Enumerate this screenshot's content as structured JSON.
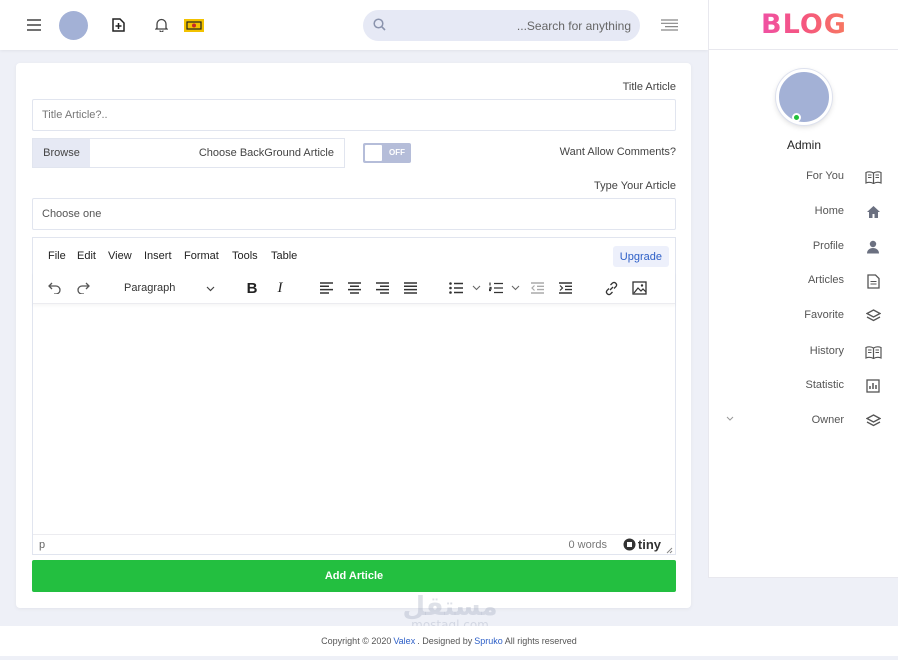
{
  "header": {
    "search_placeholder": "...Search for anything"
  },
  "sidebar": {
    "logo": "BLOG",
    "user_name": "Admin",
    "items": [
      {
        "label": "For You",
        "icon": "book-open-icon"
      },
      {
        "label": "Home",
        "icon": "home-icon"
      },
      {
        "label": "Profile",
        "icon": "user-icon"
      },
      {
        "label": "Articles",
        "icon": "document-icon"
      },
      {
        "label": "Favorite",
        "icon": "layers-icon"
      },
      {
        "label": "History",
        "icon": "book-open-icon"
      },
      {
        "label": "Statistic",
        "icon": "bar-chart-icon"
      },
      {
        "label": "Owner",
        "icon": "layers-icon"
      }
    ]
  },
  "form": {
    "title_label": "Title Article",
    "title_placeholder": "Title Article?..",
    "browse_label": "Browse",
    "background_label": "Choose BackGround Article",
    "toggle_state": "OFF",
    "comments_label": "Want Allow Comments?",
    "type_label": "Type Your Article",
    "type_value": "Choose one",
    "submit_label": "Add Article"
  },
  "editor": {
    "menu": [
      "File",
      "Edit",
      "View",
      "Insert",
      "Format",
      "Tools",
      "Table"
    ],
    "upgrade_label": "Upgrade",
    "block_format": "Paragraph",
    "status_path": "p",
    "word_count": "0 words",
    "brand": "tiny"
  },
  "footer": {
    "prefix": "Copyright © 2020",
    "link1": "Valex",
    "middle": ". Designed by",
    "link2": "Spruko",
    "suffix": "All rights reserved"
  },
  "watermark": {
    "arabic": "مستقل",
    "latin": "mostaql.com"
  },
  "colors": {
    "accent_green": "#23bf40",
    "link_blue": "#2d5fc7",
    "avatar": "#a3b1d6",
    "online": "#22c03c"
  }
}
